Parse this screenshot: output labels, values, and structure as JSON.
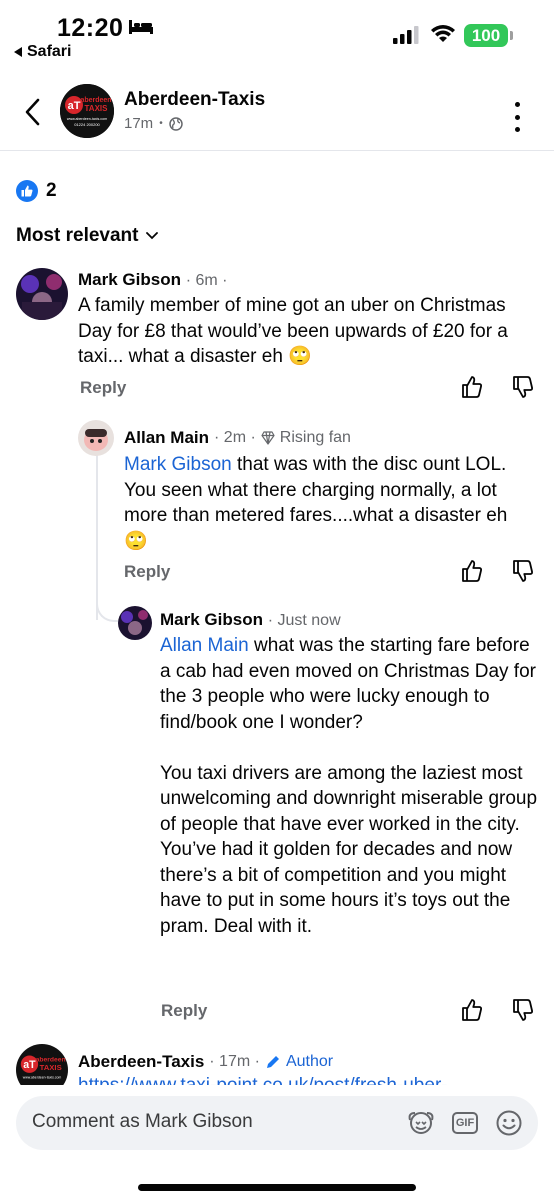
{
  "status_bar": {
    "time": "12:20",
    "back_app": "Safari",
    "battery": "100",
    "colors": {
      "battery": "#32c759"
    }
  },
  "header": {
    "title": "Aberdeen-Taxis",
    "subtitle": "17m",
    "visibility_icon": "globe-icon",
    "logo_text": "aT",
    "logo_word": "aberdeen",
    "logo_word_2": "TAXIS",
    "logo_site": "www.aberdeen-taxis.com",
    "logo_phone": "01224 200200"
  },
  "reactions": {
    "count": "2",
    "icon": "like-icon"
  },
  "sort": {
    "label": "Most relevant"
  },
  "comments": [
    {
      "author": "Mark Gibson",
      "meta": "· 6m ·",
      "text": "A family member of mine got an uber on Christmas Day for £8 that would’ve been upwards of £20 for a taxi... what a disaster eh 🙄",
      "reply_label": "Reply"
    },
    {
      "author": "Allan Main",
      "meta": "· 2m ·",
      "badge": "Rising fan",
      "mention": "Mark Gibson",
      "text": " that was with the disc ount LOL. You seen what there charging normally, a lot more than metered fares....what a disaster eh 🙄",
      "reply_label": "Reply"
    },
    {
      "author": "Mark Gibson",
      "meta": "· Just now",
      "mention": "Allan Main",
      "text": " what was the starting fare before a cab had even moved on Christmas Day for the 3 people who were lucky enough to find/book one I wonder?\n\nYou taxi drivers are among the laziest most unwelcoming and downright miserable group of people that have ever worked in the city.  You’ve had it golden for decades and now there’s a bit of competition and you might have to put in some hours it’s toys out the pram. Deal with it.",
      "reply_label": "Reply"
    },
    {
      "author": "Aberdeen-Taxis",
      "meta": "· 17m ·",
      "badge": "Author",
      "link": "https://www.taxi-point.co.uk/post/fresh-uber-"
    }
  ],
  "composer": {
    "placeholder": "Comment as Mark Gibson",
    "gif_label": "GIF"
  },
  "colors": {
    "accent": "#1877f2",
    "mention": "#1b64d4",
    "meta": "#65676b"
  }
}
